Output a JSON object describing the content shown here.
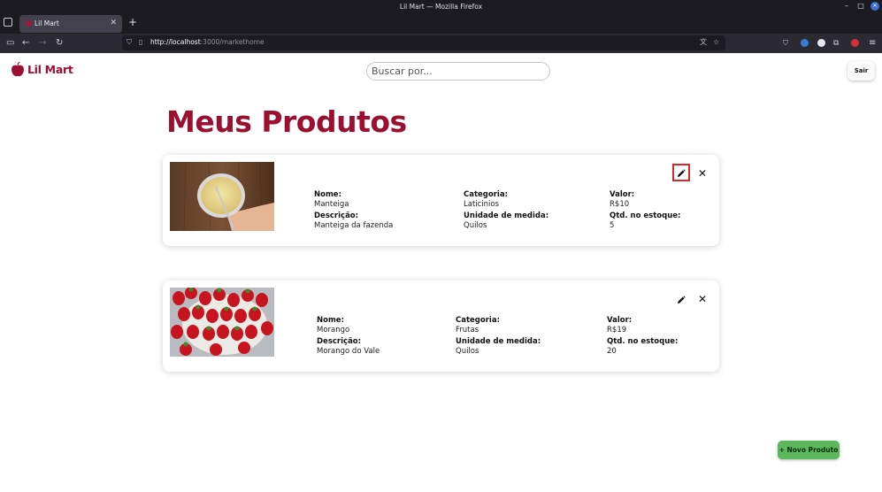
{
  "window": {
    "title": "Lil Mart — Mozilla Firefox"
  },
  "browser": {
    "tab_title": "Lil Mart",
    "url_host": "http://localhost",
    "url_rest": ":3000/markethome"
  },
  "header": {
    "logo_text": "Lil Mart",
    "search_placeholder": "Buscar por...",
    "logout_label": "Sair"
  },
  "main": {
    "title": "Meus Produtos",
    "labels": {
      "name": "Nome:",
      "description": "Descrição:",
      "category": "Categoria:",
      "unit": "Unidade de medida:",
      "price": "Valor:",
      "stock": "Qtd. no estoque:"
    },
    "products": [
      {
        "name": "Manteiga",
        "description": "Manteiga da fazenda",
        "category": "Laticinios",
        "unit": "Quilos",
        "price": "R$10",
        "stock": "5",
        "image": "butter-photo"
      },
      {
        "name": "Morango",
        "description": "Morango do Vale",
        "category": "Frutas",
        "unit": "Quilos",
        "price": "R$19",
        "stock": "20",
        "image": "strawberries-photo"
      }
    ],
    "new_product_label": "+ Novo Produto"
  },
  "colors": {
    "brand": "#9b1030",
    "new_button": "#5cb85c",
    "highlight": "#e0242c"
  },
  "icons": [
    "edit-pencil-icon",
    "delete-x-icon",
    "apple-logo-icon"
  ]
}
